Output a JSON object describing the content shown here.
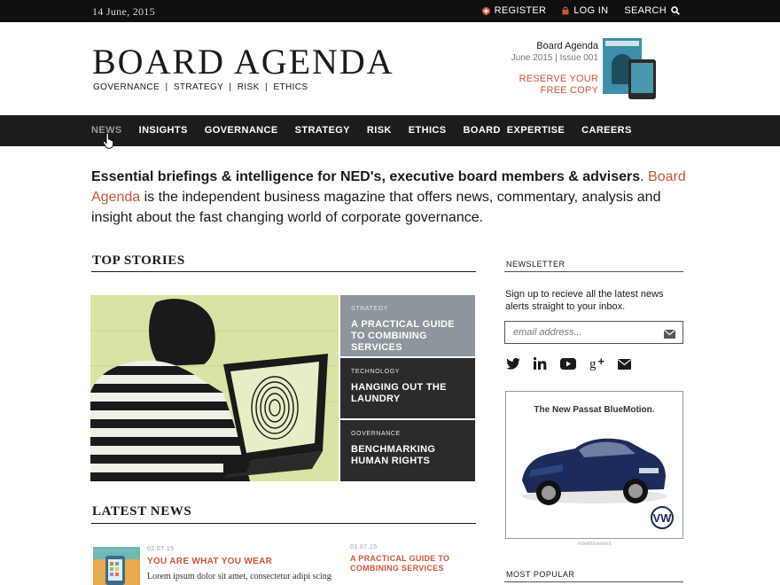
{
  "topbar": {
    "date": "14 June, 2015",
    "register": "REGISTER",
    "login": "LOG IN",
    "search": "SEARCH"
  },
  "header": {
    "logo": "BOARD AGENDA",
    "tagline": "GOVERNANCE  |  STRATEGY  |  RISK  |  ETHICS",
    "issue_title": "Board Agenda",
    "issue_meta": "June 2015 | Issue 001",
    "reserve_line1": "RESERVE YOUR",
    "reserve_line2": "FREE COPY"
  },
  "nav": [
    "NEWS",
    "INSIGHTS",
    "GOVERNANCE",
    "STRATEGY",
    "RISK",
    "ETHICS",
    "BOARD  EXPERTISE",
    "CAREERS"
  ],
  "intro": {
    "bold": "Essential briefings & intelligence for NED's, executive board members & advisers",
    "dot": ".",
    "brand": "Board Agenda",
    "rest": " is the independent business magazine that offers news, commentary, analysis and insight about the fast changing world of corporate governance."
  },
  "top_stories": {
    "heading": "TOP STORIES",
    "items": [
      {
        "category": "STRATEGY",
        "title": "A PRACTICAL GUIDE TO COMBINING SERVICES"
      },
      {
        "category": "TECHNOLOGY",
        "title": "HANGING OUT THE LAUNDRY"
      },
      {
        "category": "GOVERNANCE",
        "title": "BENCHMARKING HUMAN RIGHTS"
      }
    ]
  },
  "latest_news": {
    "heading": "LATEST NEWS",
    "items": [
      {
        "date": "02.07.15",
        "title": "YOU ARE WHAT YOU WEAR",
        "excerpt": "Lorem ipsum dolor sit amet, consectetur adipi scing"
      },
      {
        "date": "01.07.15",
        "title_line1": "A PRACTICAL GUIDE TO",
        "title_line2": "COMBINING SERVICES"
      }
    ]
  },
  "sidebar": {
    "newsletter_heading": "NEWSLETTER",
    "newsletter_text": "Sign up to recieve all the latest news alerts straight to your inbox.",
    "email_placeholder": "email address...",
    "social_icons": [
      "twitter-icon",
      "linkedin-icon",
      "youtube-icon",
      "google-plus-icon",
      "mail-icon"
    ],
    "ad_headline": "The New Passat BlueMotion.",
    "ad_label": "Advertisement",
    "most_popular_heading": "MOST POPULAR"
  },
  "colors": {
    "accent": "#c9573a",
    "nav_bg": "#1c1c1c",
    "story_grey": "#8c969b",
    "story_dark": "#2b2b2b",
    "hero_bg": "#d9e3a3"
  }
}
